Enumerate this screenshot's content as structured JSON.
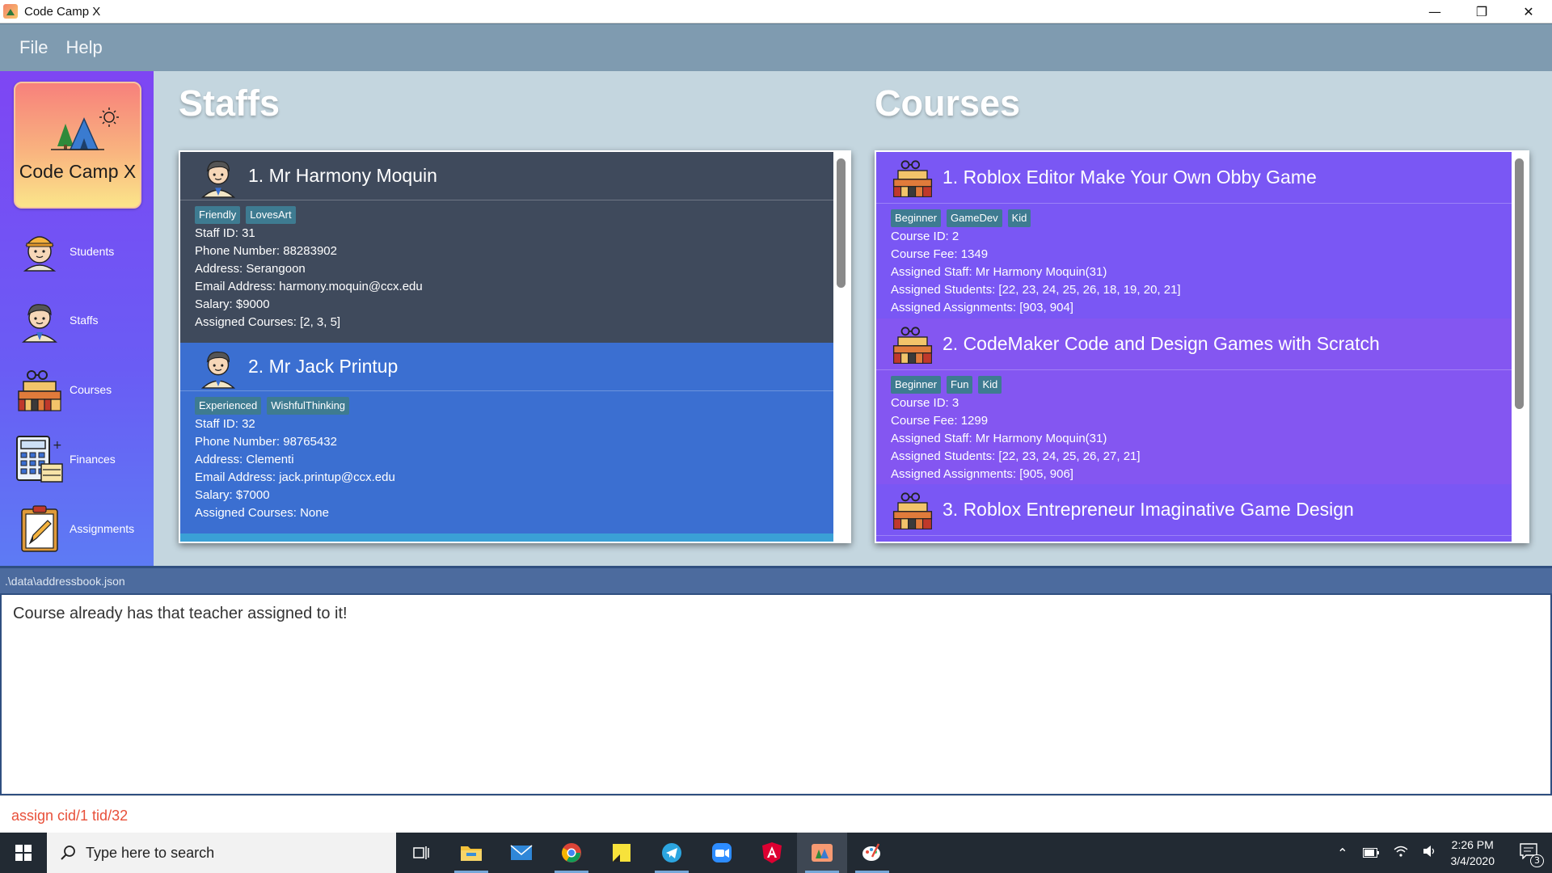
{
  "window": {
    "title": "Code Camp X",
    "controls": [
      "—",
      "❐",
      "✕"
    ]
  },
  "menu": {
    "items": [
      "File",
      "Help"
    ]
  },
  "sidebar": {
    "logo_text": "Code Camp X",
    "items": [
      {
        "label": "Students",
        "icon": "student-icon"
      },
      {
        "label": "Staffs",
        "icon": "staff-icon"
      },
      {
        "label": "Courses",
        "icon": "courses-icon"
      },
      {
        "label": "Finances",
        "icon": "calculator-icon"
      },
      {
        "label": "Assignments",
        "icon": "clipboard-icon"
      }
    ]
  },
  "staffs": {
    "heading": "Staffs",
    "items": [
      {
        "title": "1.  Mr Harmony Moquin",
        "tags": [
          "Friendly",
          "LovesArt"
        ],
        "lines": [
          "Staff ID: 31",
          "Phone Number: 88283902",
          "Address: Serangoon",
          "Email Address: harmony.moquin@ccx.edu",
          "Salary: $9000",
          "Assigned Courses: [2, 3, 5]"
        ]
      },
      {
        "title": "2.  Mr Jack Printup",
        "tags": [
          "Experienced",
          "WishfulThinking"
        ],
        "lines": [
          "Staff ID: 32",
          "Phone Number: 98765432",
          "Address: Clementi",
          "Email Address: jack.printup@ccx.edu",
          "Salary: $7000",
          "Assigned Courses: None"
        ]
      }
    ]
  },
  "courses": {
    "heading": "Courses",
    "items": [
      {
        "title": "1.  Roblox Editor Make Your Own Obby Game",
        "tags": [
          "Beginner",
          "GameDev",
          "Kid"
        ],
        "lines": [
          "Course ID: 2",
          "Course Fee: 1349",
          "Assigned Staff: Mr Harmony Moquin(31)",
          "Assigned Students: [22, 23, 24, 25, 26, 18, 19, 20, 21]",
          "Assigned Assignments: [903, 904]"
        ]
      },
      {
        "title": "2.  CodeMaker Code and Design Games with Scratch",
        "tags": [
          "Beginner",
          "Fun",
          "Kid"
        ],
        "lines": [
          "Course ID: 3",
          "Course Fee: 1299",
          "Assigned Staff: Mr Harmony Moquin(31)",
          "Assigned Students: [22, 23, 24, 25, 26, 27, 21]",
          "Assigned Assignments: [905, 906]"
        ]
      },
      {
        "title": "3.  Roblox Entrepreneur Imaginative Game Design",
        "tags": [],
        "lines": []
      }
    ]
  },
  "status": {
    "path": ".\\data\\addressbook.json"
  },
  "result": {
    "text": "Course already has that teacher assigned to it!"
  },
  "command": {
    "text": "assign cid/1 tid/32"
  },
  "taskbar": {
    "search_placeholder": "Type here to search",
    "apps": [
      "task-view-icon",
      "file-explorer-icon",
      "mail-icon",
      "chrome-icon",
      "sticky-notes-icon",
      "telegram-icon",
      "zoom-icon",
      "angular-icon",
      "code-camp-x-icon",
      "paint-icon"
    ],
    "time": "2:26 PM",
    "date": "3/4/2020",
    "notification_count": "3"
  }
}
